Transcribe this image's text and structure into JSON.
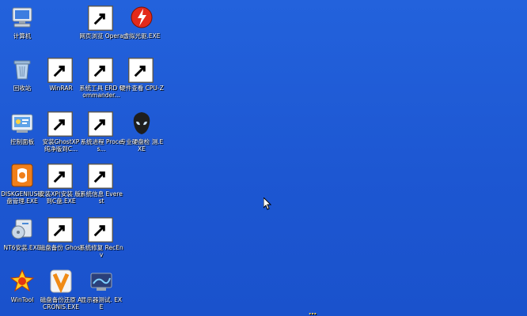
{
  "desktop": {
    "icons": [
      {
        "id": "computer",
        "label": "计算机",
        "icon": "computer-icon",
        "shortcut": false
      },
      {
        "id": "opera",
        "label": "网页浏览 Opera",
        "icon": "opera-icon",
        "shortcut": true
      },
      {
        "id": "daemon",
        "label": "虚拟光驱.EXE",
        "icon": "virtual-drive-icon",
        "shortcut": false
      },
      {
        "id": "recycle",
        "label": "回收站",
        "icon": "recycle-bin-icon",
        "shortcut": false
      },
      {
        "id": "winrar",
        "label": "WinRAR",
        "icon": "winrar-icon",
        "shortcut": true
      },
      {
        "id": "erd",
        "label": "系统工具 ERD Commander...",
        "icon": "erd-commander-icon",
        "shortcut": true
      },
      {
        "id": "cpuz",
        "label": "硬件查看 CPU-Z",
        "icon": "cpu-z-icon",
        "shortcut": true
      },
      {
        "id": "control",
        "label": "控制面板",
        "icon": "control-panel-icon",
        "shortcut": false
      },
      {
        "id": "ghostxp",
        "label": "安装GhostXP 纯净版到C...",
        "icon": "ghost-install-icon",
        "shortcut": true
      },
      {
        "id": "process",
        "label": "系统进程 Proces...",
        "icon": "process-icon",
        "shortcut": true
      },
      {
        "id": "diskcheck",
        "label": "专业硬盘检 测.EXE",
        "icon": "alien-icon",
        "shortcut": false
      },
      {
        "id": "diskgenius",
        "label": "DISKGENIUS磁 盘管理.EXE",
        "icon": "diskgenius-icon",
        "shortcut": false
      },
      {
        "id": "xpinstall",
        "label": "安装XP(安装 版)到C盘.EXE",
        "icon": "xp-install-icon",
        "shortcut": true
      },
      {
        "id": "everest",
        "label": "系统信息 Everest",
        "icon": "everest-icon",
        "shortcut": true
      },
      {
        "id": "nt6",
        "label": "NT6安装.EXE",
        "icon": "nt6-icon",
        "shortcut": false
      },
      {
        "id": "ghostbackup",
        "label": "磁盘备份 Ghost",
        "icon": "ghost-icon",
        "shortcut": true
      },
      {
        "id": "recenv",
        "label": "系统修复 RecEnv",
        "icon": "recenv-icon",
        "shortcut": true
      },
      {
        "id": "wintool",
        "label": "WinTool",
        "icon": "wintool-icon",
        "shortcut": false
      },
      {
        "id": "acronis",
        "label": "磁盘备份还原 ACRONIS.EXE",
        "icon": "acronis-icon",
        "shortcut": false
      },
      {
        "id": "monitor",
        "label": "显示器测试. EXE",
        "icon": "monitor-test-icon",
        "shortcut": false
      }
    ]
  },
  "cursor": {
    "icon": "mouse-pointer-icon"
  },
  "partial_text": "…"
}
